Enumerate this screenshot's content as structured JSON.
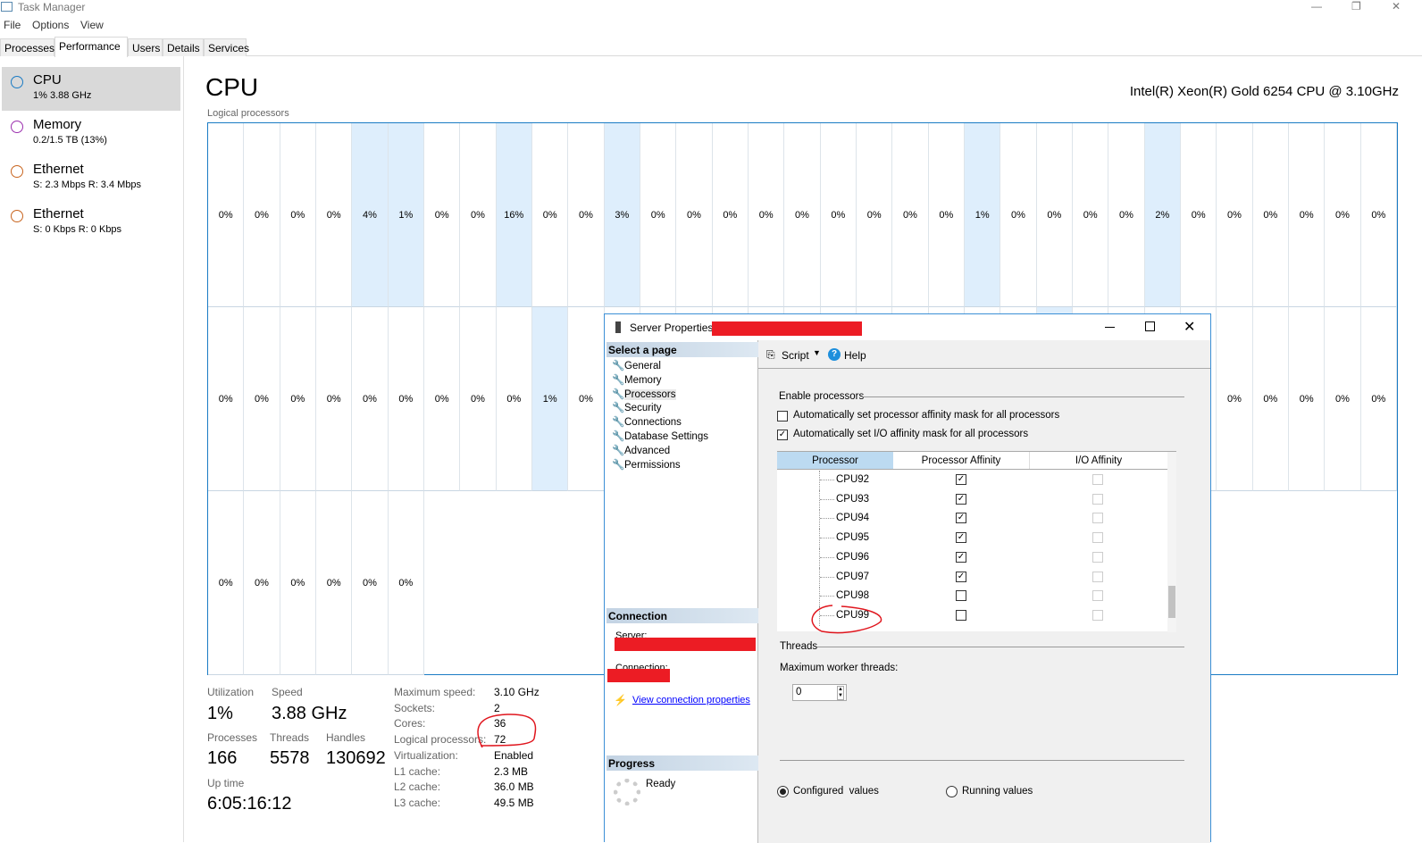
{
  "window": {
    "title": "Task Manager",
    "minimize": "—",
    "restore": "❐",
    "close": "✕"
  },
  "menu": [
    "File",
    "Options",
    "View"
  ],
  "tabs": [
    "Processes",
    "Performance",
    "Users",
    "Details",
    "Services"
  ],
  "active_tab": "Performance",
  "sidebar": [
    {
      "title": "CPU",
      "sub": "1%  3.88 GHz",
      "color": "#1a7bc4"
    },
    {
      "title": "Memory",
      "sub": "0.2/1.5 TB (13%)",
      "color": "#9b2fae"
    },
    {
      "title": "Ethernet",
      "sub": "S: 2.3 Mbps  R: 3.4 Mbps",
      "color": "#c8641e"
    },
    {
      "title": "Ethernet",
      "sub": "S: 0 Kbps  R: 0 Kbps",
      "color": "#c8641e"
    }
  ],
  "main": {
    "title": "CPU",
    "model": "Intel(R) Xeon(R) Gold 6254 CPU @ 3.10GHz",
    "graph_label": "Logical processors"
  },
  "cpu_grid": {
    "row1": [
      0,
      0,
      0,
      0,
      4,
      1,
      0,
      0,
      16,
      0,
      0,
      3,
      0,
      0,
      0,
      0,
      0,
      0,
      0,
      0,
      0,
      1,
      0,
      0,
      0,
      0,
      2,
      0,
      0,
      0,
      0,
      0,
      0
    ],
    "row2": [
      0,
      0,
      0,
      0,
      0,
      0,
      0,
      0,
      0,
      1,
      0,
      null,
      null,
      null,
      null,
      null,
      null,
      null,
      null,
      null,
      null,
      null,
      null,
      null,
      null,
      null,
      null,
      null,
      0,
      0,
      0,
      0,
      0
    ],
    "row3": [
      0,
      0,
      0,
      0,
      0,
      0
    ],
    "highlight_color": "#deeefc"
  },
  "stats": {
    "utilization_label": "Utilization",
    "utilization": "1%",
    "speed_label": "Speed",
    "speed": "3.88 GHz",
    "processes_label": "Processes",
    "processes": "166",
    "threads_label": "Threads",
    "threads": "5578",
    "handles_label": "Handles",
    "handles": "130692",
    "uptime_label": "Up time",
    "uptime": "6:05:16:12",
    "details": [
      {
        "k": "Maximum speed:",
        "v": "3.10 GHz"
      },
      {
        "k": "Sockets:",
        "v": "2"
      },
      {
        "k": "Cores:",
        "v": "36"
      },
      {
        "k": "Logical processors:",
        "v": "72"
      },
      {
        "k": "Virtualization:",
        "v": "Enabled"
      },
      {
        "k": "L1 cache:",
        "v": "2.3 MB"
      },
      {
        "k": "L2 cache:",
        "v": "36.0 MB"
      },
      {
        "k": "L3 cache:",
        "v": "49.5 MB"
      }
    ]
  },
  "dialog": {
    "title": "Server Properties -",
    "select_page": "Select a page",
    "pages": [
      "General",
      "Memory",
      "Processors",
      "Security",
      "Connections",
      "Database Settings",
      "Advanced",
      "Permissions"
    ],
    "active_page": "Processors",
    "connection": "Connection",
    "server_label": "Server:",
    "connection_label": "Connection:",
    "view_conn": "View connection properties",
    "progress": "Progress",
    "ready": "Ready",
    "script": "Script",
    "help": "Help",
    "enable_processors": "Enable processors",
    "auto_proc": "Automatically set processor affinity mask for all processors",
    "auto_proc_checked": false,
    "auto_io": "Automatically set I/O affinity mask for all processors",
    "auto_io_checked": true,
    "columns": [
      "Processor",
      "Processor Affinity",
      "I/O Affinity"
    ],
    "rows": [
      {
        "name": "CPU92",
        "proc": true,
        "io": false
      },
      {
        "name": "CPU93",
        "proc": true,
        "io": false
      },
      {
        "name": "CPU94",
        "proc": true,
        "io": false
      },
      {
        "name": "CPU95",
        "proc": true,
        "io": false
      },
      {
        "name": "CPU96",
        "proc": true,
        "io": false
      },
      {
        "name": "CPU97",
        "proc": true,
        "io": false
      },
      {
        "name": "CPU98",
        "proc": false,
        "io": false
      },
      {
        "name": "CPU99",
        "proc": false,
        "io": false
      }
    ],
    "threads": "Threads",
    "max_worker": "Maximum worker threads:",
    "max_worker_value": "0",
    "configured": "Configured  values",
    "running": "Running values",
    "selected_mode": "configured"
  },
  "annotation_color": "#e0161e"
}
